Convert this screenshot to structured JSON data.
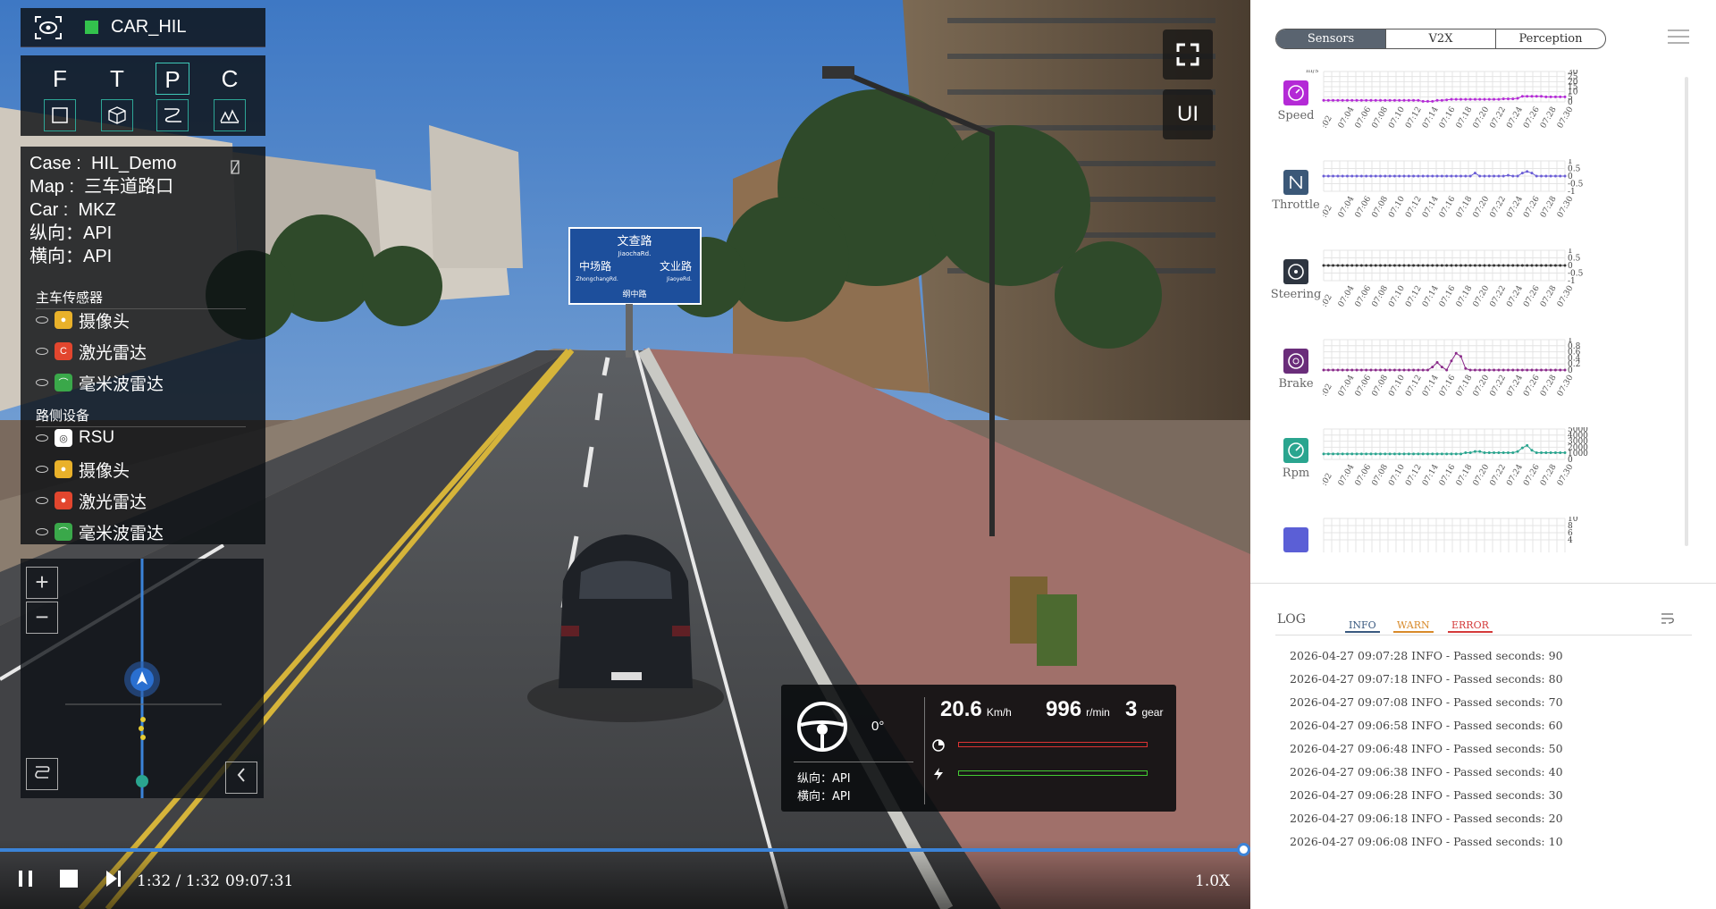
{
  "app": {
    "name": "CAR_HIL"
  },
  "modes": [
    "F",
    "T",
    "P",
    "C"
  ],
  "info": {
    "case_label": "Case :",
    "case_value": "HIL_Demo",
    "map_label": "Map :",
    "map_value": "三车道路口",
    "car_label": "Car :",
    "car_value": "MKZ",
    "lon_label": "纵向：API",
    "lat_label": "横向：API"
  },
  "ego_sensors": {
    "title": "主车传感器",
    "items": [
      "摄像头",
      "激光雷达",
      "毫米波雷达"
    ]
  },
  "roadside": {
    "title": "路侧设备",
    "items": [
      "RSU",
      "摄像头",
      "激光雷达",
      "毫米波雷达"
    ]
  },
  "minimap": {
    "zoom_in": "+",
    "zoom_out": "−"
  },
  "view": {
    "ui_label": "UI"
  },
  "signs": {
    "top": "文查路",
    "top_py": "JiaochaRd.",
    "left": "中场路",
    "left_py": "ZhongchangRd.",
    "right": "文业路",
    "right_py": "JiaoyeRd.",
    "bottom": "纲中路"
  },
  "hud": {
    "angle": "0°",
    "speed": "20.6",
    "speed_unit": "Km/h",
    "rpm": "996",
    "rpm_unit": "r/min",
    "gear": "3",
    "gear_unit": "gear",
    "lon": "纵向：API",
    "lat": "横向：API",
    "brake_level": 0.0,
    "throttle_level": 0.0
  },
  "player": {
    "time": "1:32 / 1:32",
    "clock": "09:07:31",
    "speed": "1.0X",
    "progress": 1.0
  },
  "tabs": [
    "Sensors",
    "V2X",
    "Perception"
  ],
  "active_tab": "Sensors",
  "x_ticks": [
    ":02",
    "07:04",
    "07:06",
    "07:08",
    "07:10",
    "07:12",
    "07:14",
    "07:16",
    "07:18",
    "07:20",
    "07:22",
    "07:24",
    "07:26",
    "07:28",
    "07:30"
  ],
  "chart_data": [
    {
      "type": "line",
      "name": "Speed",
      "unit": "m/s",
      "color": "#b42ad6",
      "ylim": [
        0,
        30
      ],
      "yticks": [
        "30",
        "25",
        "20",
        "15",
        "10",
        "5",
        "0"
      ],
      "values": [
        1.5,
        1.5,
        1.5,
        1.5,
        1.5,
        1.5,
        1.5,
        1.5,
        1.5,
        1.5,
        1.5,
        1.5,
        1.5,
        1.5,
        1.5,
        1.5,
        1.5,
        1.5,
        1.5,
        1.5,
        1.5,
        0.5,
        0.5,
        0.5,
        1.5,
        1.5,
        2.0,
        2.5,
        2.5,
        2.5,
        2.5,
        2.5,
        2.5,
        2.5,
        2.5,
        2.5,
        2.5,
        2.5,
        3.0,
        3.0,
        3.0,
        3.5,
        5.5,
        5.5,
        5.5,
        5.5,
        5.5,
        5.0,
        5.0,
        5.0,
        5.0,
        5.0
      ]
    },
    {
      "type": "line",
      "name": "Throttle",
      "color": "#6b5ed6",
      "ylim": [
        -1,
        1
      ],
      "yticks": [
        "1",
        "0.5",
        "0",
        "-0.5",
        "-1"
      ],
      "values": [
        0,
        0,
        0,
        0,
        0,
        0,
        0,
        0,
        0,
        0,
        0,
        0,
        0,
        0,
        0,
        0,
        0,
        0,
        0,
        0,
        0,
        0,
        0,
        0,
        0,
        0,
        0,
        0,
        0,
        0,
        0,
        0,
        0.2,
        0,
        0,
        0,
        0,
        0,
        0,
        0.05,
        0,
        0,
        0.2,
        0.3,
        0.2,
        0,
        0,
        0,
        0,
        0,
        0,
        0
      ]
    },
    {
      "type": "line",
      "name": "Steering",
      "color": "#333333",
      "ylim": [
        -1,
        1
      ],
      "yticks": [
        "1",
        "0.5",
        "0",
        "-0.5",
        "-1"
      ],
      "values": [
        0,
        0,
        0,
        0,
        0,
        0,
        0,
        0,
        0,
        0,
        0,
        0,
        0,
        0,
        0,
        0,
        0,
        0,
        0,
        0,
        0,
        0,
        0,
        0,
        0,
        0,
        0,
        0,
        0,
        0,
        0,
        0,
        0,
        0,
        0,
        0,
        0,
        0,
        0,
        0,
        0,
        0,
        0,
        0,
        0,
        0,
        0,
        0,
        0,
        0,
        0,
        0
      ]
    },
    {
      "type": "line",
      "name": "Brake",
      "color": "#8a2b8a",
      "ylim": [
        0,
        1
      ],
      "yticks": [
        "1",
        "0.8",
        "0.6",
        "0.4",
        "0.2",
        "0"
      ],
      "values": [
        0,
        0,
        0,
        0,
        0,
        0,
        0,
        0,
        0,
        0,
        0,
        0,
        0,
        0,
        0,
        0,
        0,
        0,
        0,
        0,
        0,
        0,
        0,
        0.1,
        0.25,
        0.1,
        0,
        0.3,
        0.55,
        0.45,
        0.05,
        0,
        0,
        0,
        0,
        0,
        0,
        0,
        0,
        0,
        0,
        0,
        0,
        0,
        0,
        0,
        0,
        0,
        0,
        0,
        0,
        0
      ]
    },
    {
      "type": "line",
      "name": "Rpm",
      "color": "#2aa58f",
      "ylim": [
        0,
        5000
      ],
      "yticks": [
        "5000",
        "4000",
        "3000",
        "2000",
        "1000",
        "0"
      ],
      "values": [
        900,
        900,
        900,
        900,
        900,
        900,
        900,
        900,
        900,
        900,
        900,
        900,
        900,
        900,
        900,
        900,
        900,
        900,
        900,
        900,
        900,
        900,
        900,
        900,
        900,
        900,
        900,
        900,
        900,
        900,
        1100,
        1100,
        1300,
        1300,
        1100,
        1100,
        1100,
        1100,
        1100,
        1100,
        1100,
        1300,
        1900,
        2300,
        1500,
        1100,
        1100,
        1100,
        1100,
        1100,
        1100,
        1100
      ]
    }
  ],
  "partial_chart": {
    "yticks": [
      "10",
      "8",
      "6",
      "4"
    ]
  },
  "log": {
    "title": "LOG",
    "tabs": [
      "INFO",
      "WARN",
      "ERROR"
    ],
    "lines": [
      "2026-04-27 09:07:28 INFO - Passed seconds: 90",
      "2026-04-27 09:07:18 INFO - Passed seconds: 80",
      "2026-04-27 09:07:08 INFO - Passed seconds: 70",
      "2026-04-27 09:06:58 INFO - Passed seconds: 60",
      "2026-04-27 09:06:48 INFO - Passed seconds: 50",
      "2026-04-27 09:06:38 INFO - Passed seconds: 40",
      "2026-04-27 09:06:28 INFO - Passed seconds: 30",
      "2026-04-27 09:06:18 INFO - Passed seconds: 20",
      "2026-04-27 09:06:08 INFO - Passed seconds: 10"
    ]
  },
  "colors": {
    "accent": "#3ec8b8",
    "progress": "#3b83d8",
    "status_green": "#33c24d"
  }
}
